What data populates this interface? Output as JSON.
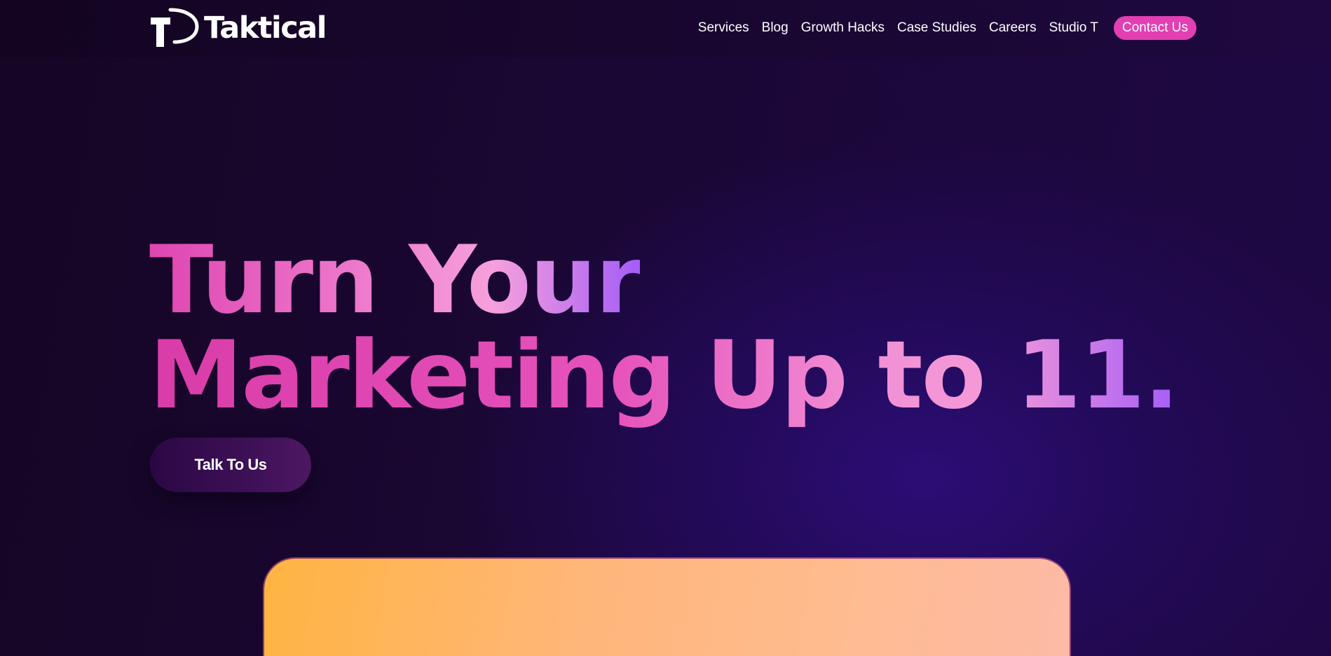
{
  "brand": {
    "name": "Taktical",
    "logo_icon": "tp-monogram-icon"
  },
  "nav": {
    "links": [
      "Services",
      "Blog",
      "Growth Hacks",
      "Case Studies",
      "Careers",
      "Studio T"
    ],
    "contact_label": "Contact Us"
  },
  "hero": {
    "line1": "Turn Your",
    "line2": "Marketing Up to 11.",
    "cta_label": "Talk To Us"
  },
  "colors": {
    "background": "#170626",
    "background_glow": "#2c0d76",
    "accent_pink": "#e23fb3",
    "accent_purple": "#a35df7",
    "card_orange": "#ffb442",
    "card_peach": "#fdbaa6",
    "cta_dark": "#2a0844"
  }
}
